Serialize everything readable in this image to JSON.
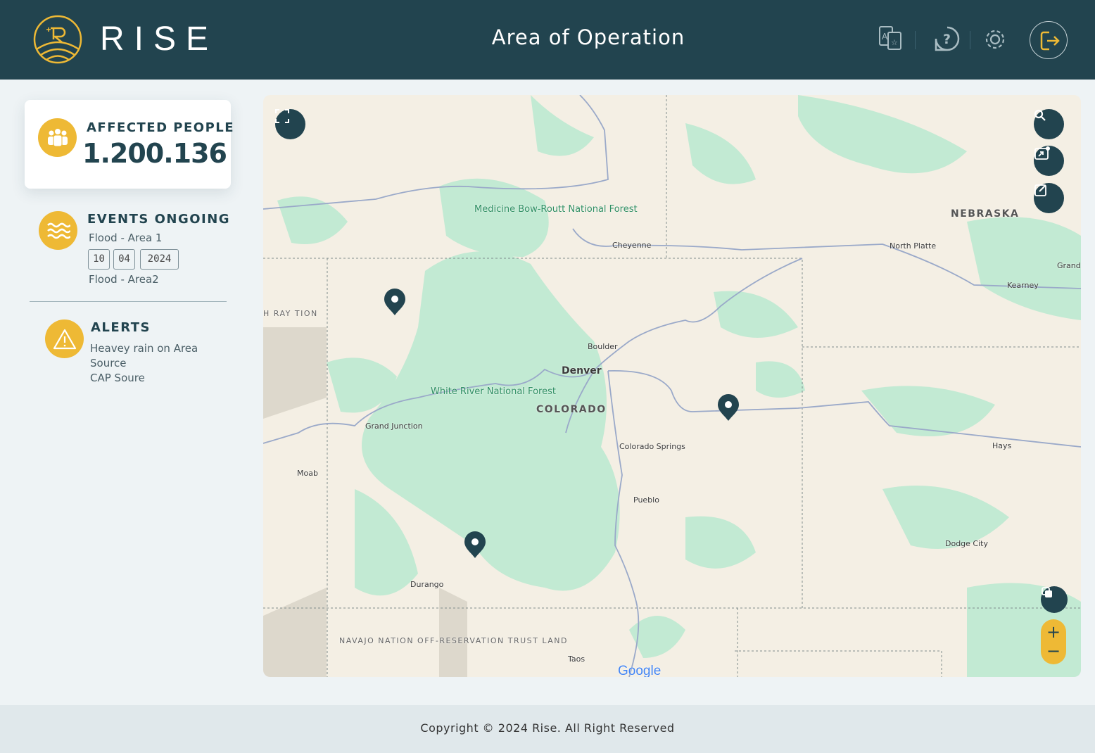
{
  "header": {
    "brand": "RISE",
    "title": "Area of Operation",
    "icons": [
      "translate-icon",
      "help-icon",
      "settings-icon",
      "logout-icon"
    ]
  },
  "sidebar": {
    "affected": {
      "label": "AFFECTED PEOPLE",
      "value": "1.200.136"
    },
    "events": {
      "label": "EVENTS ONGOING",
      "items": [
        "Flood - Area 1",
        "Flood - Area2"
      ],
      "date": {
        "day": "10",
        "month": "04",
        "year": "2024"
      }
    },
    "alerts": {
      "label": "ALERTS",
      "lines": [
        "Heavey rain on Area",
        "Source",
        "CAP Soure"
      ]
    }
  },
  "map": {
    "labels": {
      "medicine_bow": "Medicine Bow-Routt National Forest",
      "cheyenne": "Cheyenne",
      "north_platte": "North Platte",
      "nebraska": "NEBRASKA",
      "grand": "Grand",
      "kearney": "Kearney",
      "boulder": "Boulder",
      "denver": "Denver",
      "white_river": "White River National Forest",
      "colorado": "COLORADO",
      "grand_junction": "Grand Junction",
      "moab": "Moab",
      "colorado_springs": "Colorado Springs",
      "pueblo": "Pueblo",
      "hays": "Hays",
      "dodge_city": "Dodge City",
      "durango": "Durango",
      "navajo": "NAVAJO NATION OFF-RESERVATION TRUST LAND",
      "taos": "Taos",
      "utah_partial": "H RAY TION",
      "google": "Google"
    },
    "zoom_in": "+",
    "zoom_out": "−",
    "colors": {
      "land": "#f4efe4",
      "forest": "#bfe8d0",
      "pin": "#22444f",
      "accent": "#eeb935"
    }
  },
  "footer": {
    "copyright": "Copyright © 2024 Rise. All Right Reserved"
  }
}
